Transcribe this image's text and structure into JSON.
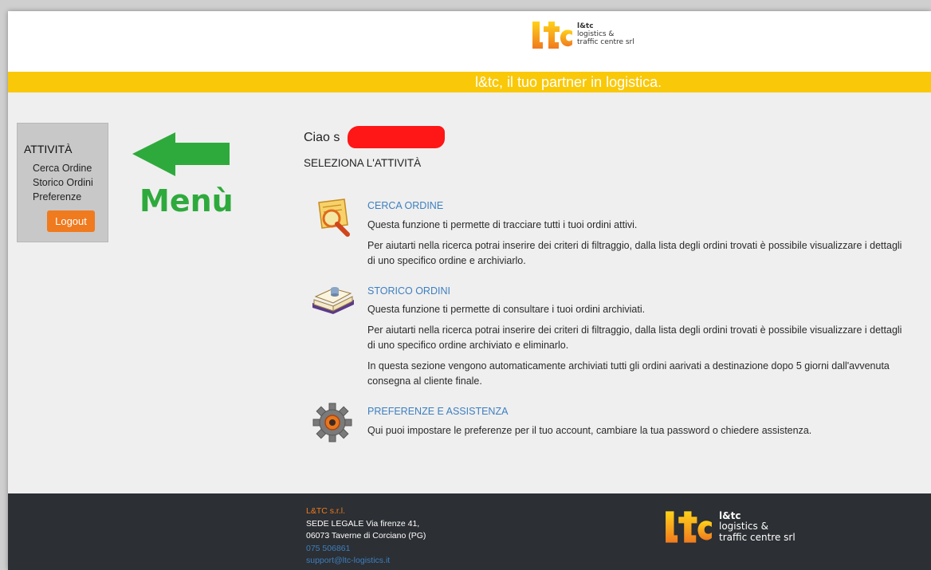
{
  "header": {
    "logo_short": "l&tc",
    "logo_line1": "logistics &",
    "logo_line2": "traffic centre srl",
    "tagline": "l&tc, il tuo partner in logistica."
  },
  "sidebar": {
    "title": "ATTIVITÀ",
    "items": [
      {
        "label": "Cerca Ordine"
      },
      {
        "label": "Storico Ordini"
      },
      {
        "label": "Preferenze"
      }
    ],
    "logout_label": "Logout"
  },
  "annotation": {
    "label": "Menù",
    "color": "#2eaa3c"
  },
  "main": {
    "greeting": "Ciao s",
    "select_heading": "SELEZIONA L'ATTIVITÀ",
    "sections": [
      {
        "title": "CERCA ORDINE",
        "icon": "search-order-icon",
        "paragraphs": [
          "Questa funzione ti permette di tracciare tutti i tuoi ordini attivi.",
          "Per aiutarti nella ricerca potrai inserire dei criteri di filtraggio, dalla lista degli ordini trovati è possibile visualizzare i dettagli di uno specifico ordine e archiviarlo."
        ]
      },
      {
        "title": "STORICO ORDINI",
        "icon": "order-history-book-icon",
        "paragraphs": [
          "Questa funzione ti permette di consultare i tuoi ordini archiviati.",
          "Per aiutarti nella ricerca potrai inserire dei criteri di filtraggio, dalla lista degli ordini trovati è possibile visualizzare i dettagli di uno specifico ordine archiviato e eliminarlo.",
          "In questa sezione vengono automaticamente archiviati tutti gli ordini aarivati a destinazione dopo 5 giorni dall'avvenuta consegna al cliente finale."
        ]
      },
      {
        "title": "PREFERENZE E ASSISTENZA",
        "icon": "gear-icon",
        "paragraphs": [
          "Qui puoi impostare le preferenze per il tuo account, cambiare la tua password o chiedere assistenza."
        ]
      }
    ]
  },
  "footer": {
    "company": "L&TC s.r.l.",
    "address_line1": "SEDE LEGALE Via firenze 41,",
    "address_line2": "06073 Taverne di Corciano (PG)",
    "phone": "075 506861",
    "email": "support@ltc-logistics.it",
    "logo_short": "l&tc",
    "logo_line1": "logistics &",
    "logo_line2": "traffic centre srl"
  },
  "colors": {
    "banner": "#f9c809",
    "accent_orange": "#f07a1e",
    "link_blue": "#3d7fc0",
    "footer_bg": "#2c2f33"
  }
}
